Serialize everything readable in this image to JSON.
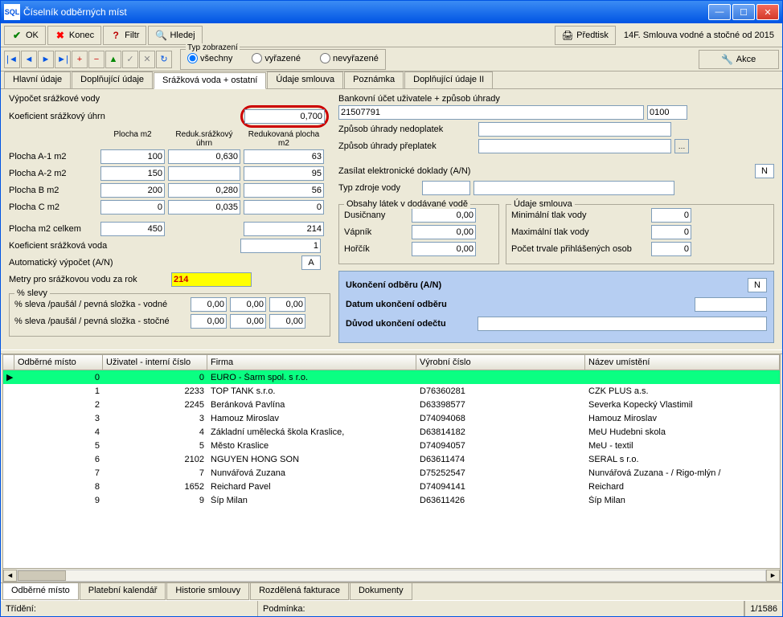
{
  "window": {
    "title": "Číselník odběrných míst"
  },
  "toolbar": {
    "ok": "OK",
    "konec": "Konec",
    "filtr": "Filtr",
    "hledej": "Hledej",
    "predtisk": "Předtisk",
    "right_label": "14F. Smlouva vodné a stočné od 2015"
  },
  "typ": {
    "legend": "Typ zobrazení",
    "opt1": "všechny",
    "opt2": "vyřazené",
    "opt3": "nevyřazené",
    "akce": "Akce"
  },
  "tabs": {
    "t1": "Hlavní údaje",
    "t2": "Doplňující údaje",
    "t3": "Srážková voda + ostatní",
    "t4": "Údaje smlouva",
    "t5": "Poznámka",
    "t6": "Doplňující údaje II"
  },
  "left": {
    "vypocet": "Výpočet srážkové vody",
    "koef_uhrn": "Koeficient srážkový úhrn",
    "koef_uhrn_val": "0,700",
    "h_plocha": "Plocha m2",
    "h_reduk": "Reduk.srážkový úhrn",
    "h_redpl": "Redukovaná plocha m2",
    "a1_lbl": "Plocha A-1 m2",
    "a1_p": "100",
    "a1_r": "0,630",
    "a1_rp": "63",
    "a2_lbl": "Plocha A-2 m2",
    "a2_p": "150",
    "a2_r": "",
    "a2_rp": "95",
    "b_lbl": "Plocha B m2",
    "b_p": "200",
    "b_r": "0,280",
    "b_rp": "56",
    "c_lbl": "Plocha C m2",
    "c_p": "0",
    "c_r": "0,035",
    "c_rp": "0",
    "celkem_lbl": "Plocha m2 celkem",
    "celkem_p": "450",
    "celkem_rp": "214",
    "ksv_lbl": "Koeficient srážková voda",
    "ksv_val": "1",
    "auto_lbl": "Automatický výpočet (A/N)",
    "auto_val": "A",
    "metry_lbl": "Metry pro srážkovou vodu za rok",
    "metry_val": "214",
    "slevy_legend": "% slevy",
    "sl_vodne": "% sleva /paušál / pevná složka - vodné",
    "sl_stocne": "% sleva /paušál / pevná složka - stočné",
    "sl1": "0,00",
    "sl2": "0,00",
    "sl3": "0,00",
    "sl4": "0,00",
    "sl5": "0,00",
    "sl6": "0,00"
  },
  "right": {
    "banka_lbl": "Bankovní účet uživatele + způsob úhrady",
    "banka_val": "21507791",
    "banka_kod": "0100",
    "nedo_lbl": "Způsob úhrady nedoplatek",
    "nedo_val": "",
    "prep_lbl": "Způsob úhrady přeplatek",
    "prep_val": "",
    "edok_lbl": "Zasílat elektronické doklady (A/N)",
    "edok_val": "N",
    "typzdroj_lbl": "Typ zdroje vody",
    "typzdroj_v1": "",
    "typzdroj_v2": "",
    "obsahy_legend": "Obsahy látek v dodávané vodě",
    "dus_lbl": "Dusičnany",
    "dus_val": "0,00",
    "vap_lbl": "Vápník",
    "vap_val": "0,00",
    "hor_lbl": "Hořčík",
    "hor_val": "0,00",
    "udaje_legend": "Údaje smlouva",
    "min_lbl": "Minimální tlak vody",
    "min_val": "0",
    "max_lbl": "Maximální tlak vody",
    "max_val": "0",
    "osob_lbl": "Počet trvale přihlášených osob",
    "osob_val": "0",
    "blue": {
      "ukon_lbl": "Ukončení odběru (A/N)",
      "ukon_val": "N",
      "datum_lbl": "Datum ukončení odběru",
      "datum_val": "",
      "duvod_lbl": "Důvod ukončení odečtu",
      "duvod_val": ""
    }
  },
  "grid": {
    "cols": {
      "c1": "Odběrné místo",
      "c2": "Uživatel - interní číslo",
      "c3": "Firma",
      "c4": "Výrobní číslo",
      "c5": "Název umístění"
    },
    "rows": [
      {
        "om": "0",
        "uic": "0",
        "firma": "EURO - Šarm spol. s r.o.",
        "vc": "",
        "naz": ""
      },
      {
        "om": "1",
        "uic": "2233",
        "firma": "TOP TANK s.r.o.",
        "vc": "D76360281",
        "naz": "CZK PLUS a.s."
      },
      {
        "om": "2",
        "uic": "2245",
        "firma": "Beránková Pavlína",
        "vc": "D63398577",
        "naz": "Severka Kopecký Vlastimil"
      },
      {
        "om": "3",
        "uic": "3",
        "firma": "Hamouz Miroslav",
        "vc": "D74094068",
        "naz": "Hamouz Miroslav"
      },
      {
        "om": "4",
        "uic": "4",
        "firma": "Základní umělecká škola Kraslice,",
        "vc": "D63814182",
        "naz": "MeU  Hudebni skola"
      },
      {
        "om": "5",
        "uic": "5",
        "firma": "Město Kraslice",
        "vc": "D74094057",
        "naz": "MeU - textil"
      },
      {
        "om": "6",
        "uic": "2102",
        "firma": "NGUYEN HONG SON",
        "vc": "D63611474",
        "naz": "SERAL s r.o."
      },
      {
        "om": "7",
        "uic": "7",
        "firma": "Nunvářová Zuzana",
        "vc": "D75252547",
        "naz": "Nunvářová Zuzana -       / Rigo-mlýn /"
      },
      {
        "om": "8",
        "uic": "1652",
        "firma": "Reichard Pavel",
        "vc": "D74094141",
        "naz": "Reichard"
      },
      {
        "om": "9",
        "uic": "9",
        "firma": "Šíp Milan",
        "vc": "D63611426",
        "naz": "Šíp Milan"
      }
    ]
  },
  "bottomTabs": {
    "b1": "Odběrné místo",
    "b2": "Platební kalendář",
    "b3": "Historie smlouvy",
    "b4": "Rozdělená fakturace",
    "b5": "Dokumenty"
  },
  "status": {
    "trideni": "Třídění:",
    "podminka": "Podmínka:",
    "pos": "1/1586"
  }
}
